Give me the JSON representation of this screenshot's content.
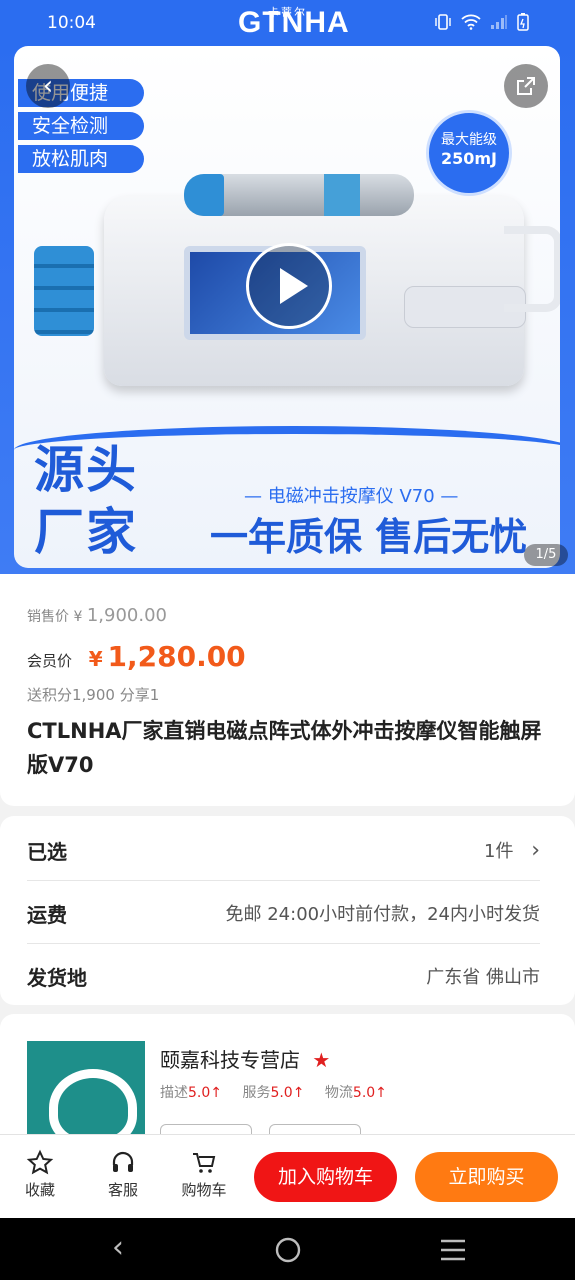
{
  "status_bar": {
    "time": "10:04",
    "logo_text": "GTNHA",
    "logo_subtext": "卡蒂尔",
    "icons": [
      "vibrate-icon",
      "wifi-icon",
      "signal-icon",
      "battery-icon"
    ]
  },
  "hero": {
    "tags": [
      "使用便捷",
      "安全检测",
      "放松肌肉"
    ],
    "energy_badge_line1": "最大能级",
    "energy_badge_line2": "250mJ",
    "big_word_1": "源头",
    "big_word_2": "厂家",
    "product_line": "— 电磁冲击按摩仪 V70 —",
    "slogan": "一年质保 售后无忧",
    "page_indicator": "1/5"
  },
  "price": {
    "sale_label": "销售价",
    "sale_currency": "¥",
    "sale_price": "1,900.00",
    "member_label": "会员价",
    "member_currency": "¥",
    "member_price": "1,280.00",
    "points_share": "送积分1,900  分享1",
    "title": "CTLNHA厂家直销电磁点阵式体外冲击按摩仪智能触屏版V70"
  },
  "info": {
    "selected_label": "已选",
    "selected_value": "1件",
    "shipping_label": "运费",
    "shipping_value": "免邮 24:00小时前付款，24内小时发货",
    "origin_label": "发货地",
    "origin_value": "广东省  佛山市"
  },
  "shop": {
    "name": "颐嘉科技专营店",
    "desc_label": "描述",
    "desc_score": "5.0↑",
    "service_label": "服务",
    "service_score": "5.0↑",
    "logistics_label": "物流",
    "logistics_score": "5.0↑"
  },
  "actions": {
    "favorite": "收藏",
    "service": "客服",
    "cart": "购物车",
    "add_to_cart": "加入购物车",
    "buy_now": "立即购买"
  },
  "colors": {
    "brand_blue": "#2b6df0",
    "price_orange": "#f25a1a",
    "cart_red": "#f01515",
    "buy_orange": "#ff7a12"
  }
}
